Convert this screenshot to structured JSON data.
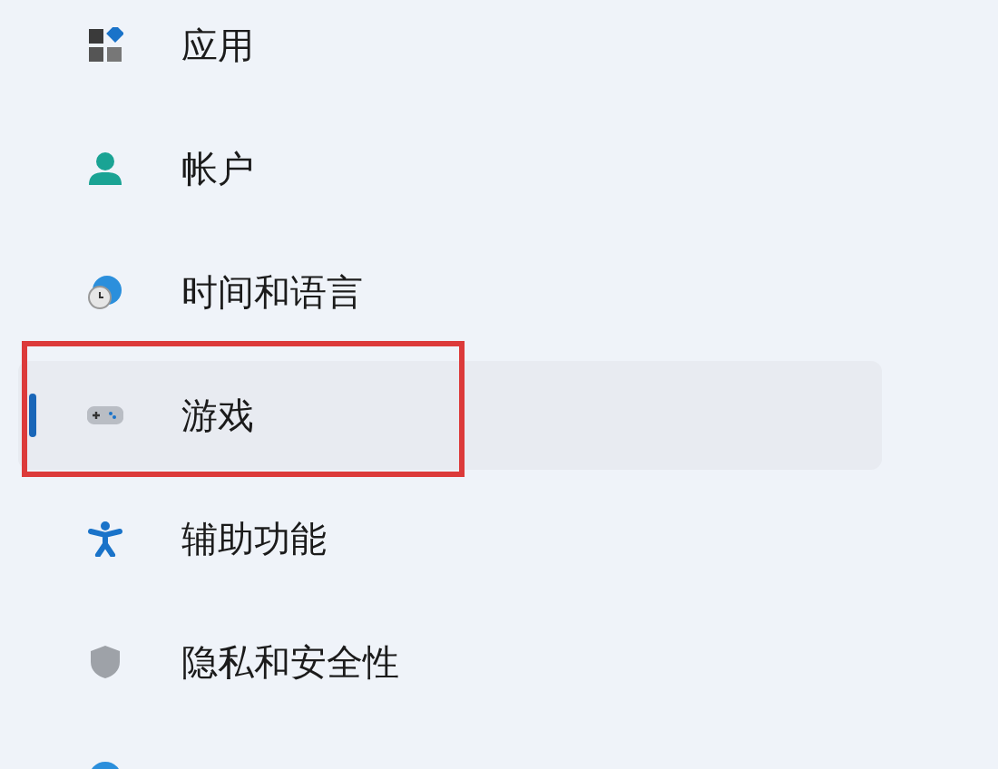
{
  "sidebar": {
    "items": [
      {
        "label": "应用",
        "selected": false,
        "highlighted": false
      },
      {
        "label": "帐户",
        "selected": false,
        "highlighted": false
      },
      {
        "label": "时间和语言",
        "selected": false,
        "highlighted": false
      },
      {
        "label": "游戏",
        "selected": true,
        "highlighted": true
      },
      {
        "label": "辅助功能",
        "selected": false,
        "highlighted": false
      },
      {
        "label": "隐私和安全性",
        "selected": false,
        "highlighted": false
      },
      {
        "selected": false,
        "highlighted": false
      }
    ]
  }
}
